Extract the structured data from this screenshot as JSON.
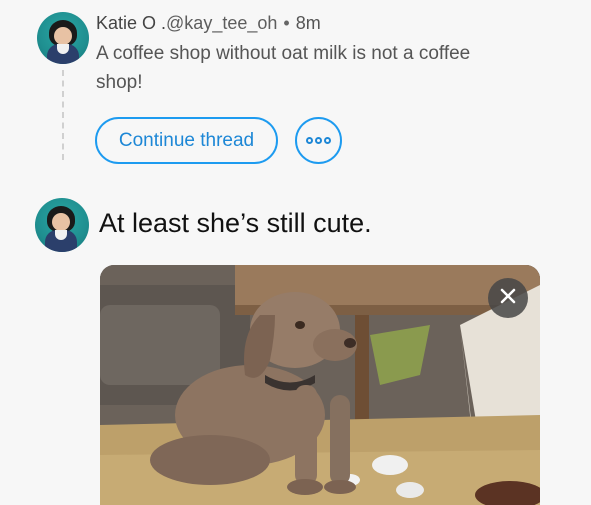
{
  "tweet1": {
    "display_name": "Katie O .",
    "handle": "@kay_tee_oh",
    "separator": "•",
    "time": "8m",
    "text": "A coffee shop without oat milk is not a coffee shop!"
  },
  "thread": {
    "continue_label": "Continue thread",
    "more_icon": "more-horizontal-icon"
  },
  "tweet2": {
    "text": "At least she’s still cute."
  },
  "media": {
    "close_icon": "close-icon"
  },
  "colors": {
    "accent": "#1d9bf0",
    "background": "#f7f7f7"
  }
}
